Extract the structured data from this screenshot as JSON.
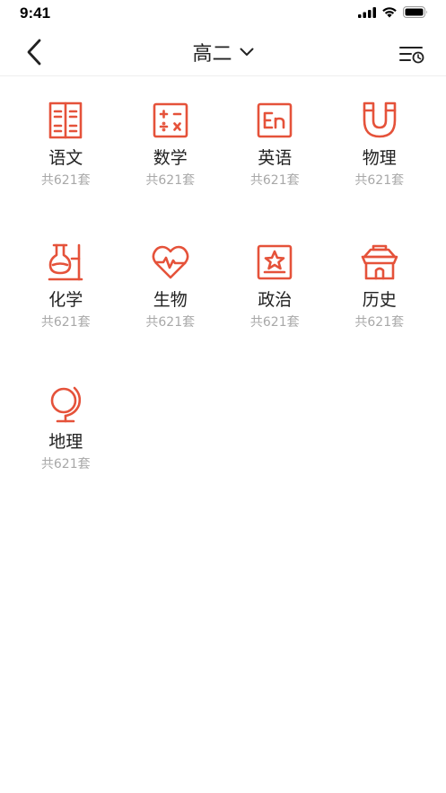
{
  "status_bar": {
    "time": "9:41"
  },
  "nav": {
    "title": "高二"
  },
  "colors": {
    "accent": "#E5523A",
    "text": "#222222",
    "subtext": "#A8A8A8"
  },
  "subjects": [
    {
      "name": "语文",
      "count": "共621套",
      "icon": "book-icon"
    },
    {
      "name": "数学",
      "count": "共621套",
      "icon": "calculator-icon"
    },
    {
      "name": "英语",
      "count": "共621套",
      "icon": "en-icon"
    },
    {
      "name": "物理",
      "count": "共621套",
      "icon": "magnet-icon"
    },
    {
      "name": "化学",
      "count": "共621套",
      "icon": "flask-icon"
    },
    {
      "name": "生物",
      "count": "共621套",
      "icon": "heartbeat-icon"
    },
    {
      "name": "政治",
      "count": "共621套",
      "icon": "star-frame-icon"
    },
    {
      "name": "历史",
      "count": "共621套",
      "icon": "pagoda-icon"
    },
    {
      "name": "地理",
      "count": "共621套",
      "icon": "globe-icon"
    }
  ]
}
